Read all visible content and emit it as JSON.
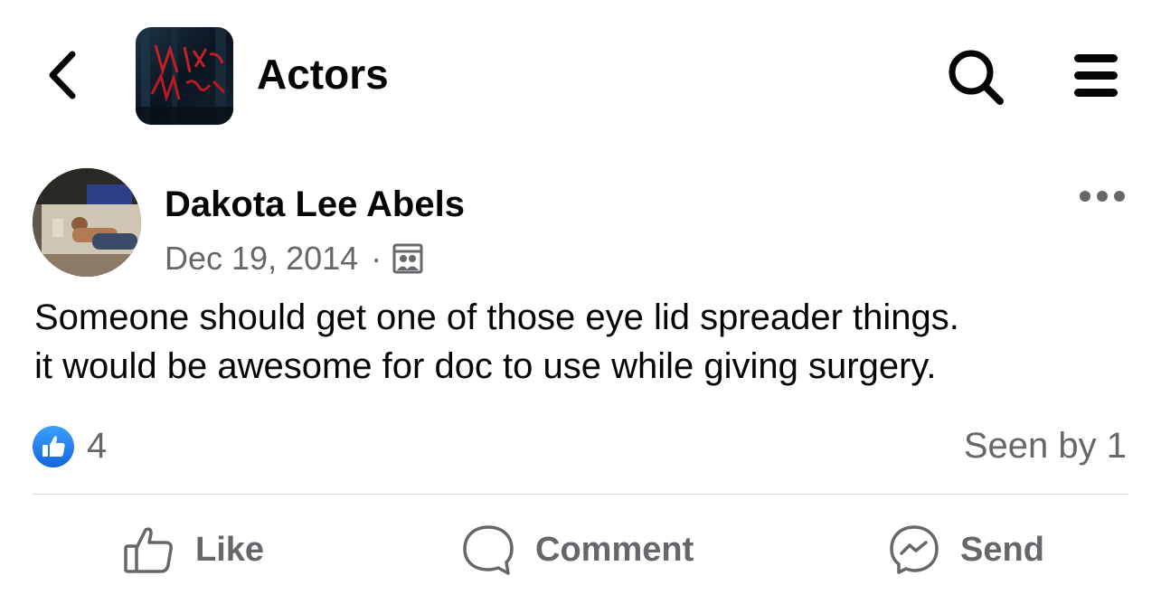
{
  "header": {
    "group_name": "Actors",
    "group_avatar_text": "Mikka"
  },
  "post": {
    "author": "Dakota Lee Abels",
    "date": "Dec 19, 2014",
    "audience_icon": "group-audience-icon",
    "text_lines": [
      "Someone should get one of those eye lid spreader things.",
      "it would be awesome for doc to use while giving surgery."
    ],
    "reactions": {
      "count": "4",
      "seen_by": "Seen by 1"
    },
    "actions": {
      "like_label": "Like",
      "comment_label": "Comment",
      "send_label": "Send"
    }
  },
  "colors": {
    "accent": "#1877f2",
    "secondary_text": "#65676b",
    "divider": "#d9dadd"
  }
}
